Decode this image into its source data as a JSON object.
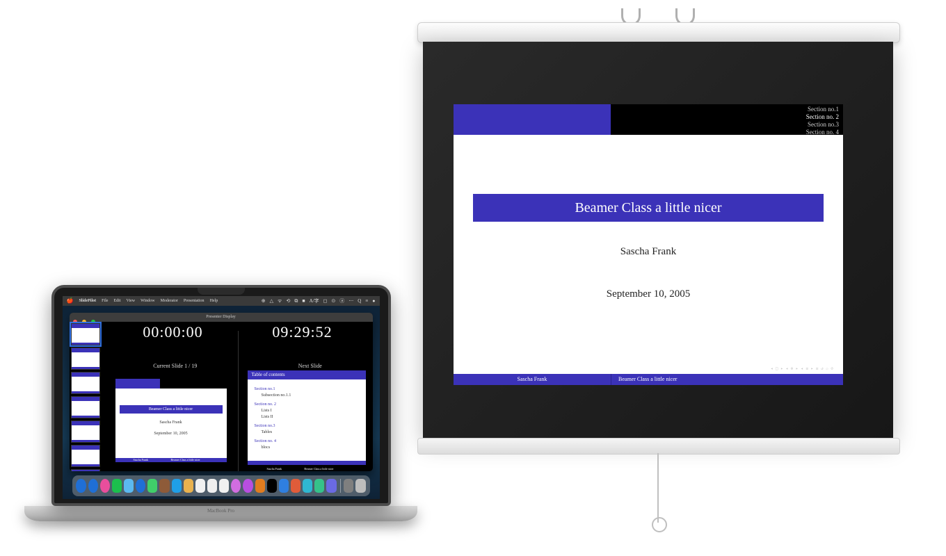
{
  "projector": {
    "sections": [
      "Section no.1",
      "Section no. 2",
      "Section no.3",
      "Section no. 4"
    ],
    "title": "Beamer Class a little nicer",
    "author": "Sascha Frank",
    "date": "September 10, 2005",
    "nav_glyphs": "◂ □ ▸ ◂ ⊕ ▸ ◂ ≡ ▸ ≡ ↺ ۞ ⊘",
    "footer_author": "Sascha Frank",
    "footer_title": "Beamer Class a little nicer"
  },
  "mac": {
    "menubar": {
      "app": "SlidePilot",
      "items": [
        "File",
        "Edit",
        "View",
        "Window",
        "Moderator",
        "Presentation",
        "Help"
      ],
      "right_glyphs": [
        "⊕",
        "△",
        "ᯤ",
        "⟲",
        "⧉",
        "■",
        "A/字",
        "◻",
        "⊙",
        "ⓐ",
        "⋯",
        "Q",
        "≡",
        "●"
      ]
    },
    "presenter": {
      "window_title": "Presenter Display",
      "elapsed": "00:00:00",
      "clock": "09:29:52",
      "current_label": "Current Slide 1 / 19",
      "next_label": "Next Slide",
      "current_slide": {
        "title": "Beamer Class a little nicer",
        "author": "Sascha Frank",
        "date": "September 10, 2005",
        "footer_author": "Sascha Frank",
        "footer_title": "Beamer Class a little nicer"
      },
      "next_slide": {
        "heading": "Table of contents",
        "toc": [
          {
            "sec": "Section no.1",
            "subs": [
              "Subsection no.1.1"
            ]
          },
          {
            "sec": "Section no. 2",
            "subs": [
              "Lists I",
              "Lists II"
            ]
          },
          {
            "sec": "Section no.3",
            "subs": [
              "Tables"
            ]
          },
          {
            "sec": "Section no. 4",
            "subs": [
              "blocs"
            ]
          }
        ],
        "footer_author": "Sascha Frank",
        "footer_title": "Beamer Class a little nicer"
      },
      "thumbnail_count": 8
    },
    "dock_colors": [
      "#1f6fd6",
      "#1f6fd6",
      "#e94e9c",
      "#1bbf4d",
      "#5bb9f0",
      "#1f6fd6",
      "#40cf6a",
      "#8e5b39",
      "#1f9fe8",
      "#e9b24e",
      "#f0f0f0",
      "#eee",
      "#f0f0f0",
      "#d16de0",
      "#b84ee0",
      "#e07c1f",
      "#000",
      "#2f7fe0",
      "#e05c3a",
      "#2fb7d1",
      "#35c28a",
      "#6a6ae3",
      "#7f7f7f",
      "#bdbdbd"
    ],
    "model_label": "MacBook Pro"
  }
}
